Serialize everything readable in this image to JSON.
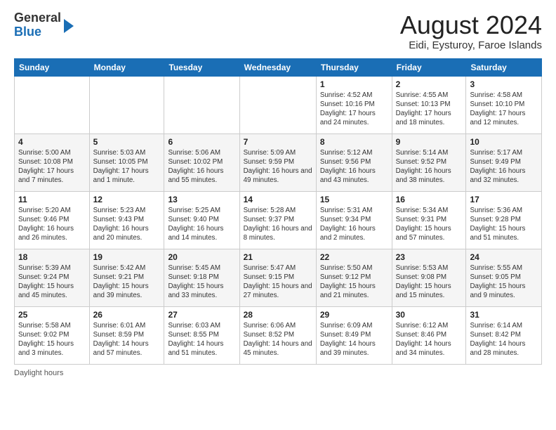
{
  "header": {
    "logo_general": "General",
    "logo_blue": "Blue",
    "month_year": "August 2024",
    "location": "Eidi, Eysturoy, Faroe Islands"
  },
  "days_of_week": [
    "Sunday",
    "Monday",
    "Tuesday",
    "Wednesday",
    "Thursday",
    "Friday",
    "Saturday"
  ],
  "footer": {
    "daylight_label": "Daylight hours"
  },
  "weeks": [
    [
      {
        "day": "",
        "info": ""
      },
      {
        "day": "",
        "info": ""
      },
      {
        "day": "",
        "info": ""
      },
      {
        "day": "",
        "info": ""
      },
      {
        "day": "1",
        "info": "Sunrise: 4:52 AM\nSunset: 10:16 PM\nDaylight: 17 hours\nand 24 minutes."
      },
      {
        "day": "2",
        "info": "Sunrise: 4:55 AM\nSunset: 10:13 PM\nDaylight: 17 hours\nand 18 minutes."
      },
      {
        "day": "3",
        "info": "Sunrise: 4:58 AM\nSunset: 10:10 PM\nDaylight: 17 hours\nand 12 minutes."
      }
    ],
    [
      {
        "day": "4",
        "info": "Sunrise: 5:00 AM\nSunset: 10:08 PM\nDaylight: 17 hours\nand 7 minutes."
      },
      {
        "day": "5",
        "info": "Sunrise: 5:03 AM\nSunset: 10:05 PM\nDaylight: 17 hours\nand 1 minute."
      },
      {
        "day": "6",
        "info": "Sunrise: 5:06 AM\nSunset: 10:02 PM\nDaylight: 16 hours\nand 55 minutes."
      },
      {
        "day": "7",
        "info": "Sunrise: 5:09 AM\nSunset: 9:59 PM\nDaylight: 16 hours\nand 49 minutes."
      },
      {
        "day": "8",
        "info": "Sunrise: 5:12 AM\nSunset: 9:56 PM\nDaylight: 16 hours\nand 43 minutes."
      },
      {
        "day": "9",
        "info": "Sunrise: 5:14 AM\nSunset: 9:52 PM\nDaylight: 16 hours\nand 38 minutes."
      },
      {
        "day": "10",
        "info": "Sunrise: 5:17 AM\nSunset: 9:49 PM\nDaylight: 16 hours\nand 32 minutes."
      }
    ],
    [
      {
        "day": "11",
        "info": "Sunrise: 5:20 AM\nSunset: 9:46 PM\nDaylight: 16 hours\nand 26 minutes."
      },
      {
        "day": "12",
        "info": "Sunrise: 5:23 AM\nSunset: 9:43 PM\nDaylight: 16 hours\nand 20 minutes."
      },
      {
        "day": "13",
        "info": "Sunrise: 5:25 AM\nSunset: 9:40 PM\nDaylight: 16 hours\nand 14 minutes."
      },
      {
        "day": "14",
        "info": "Sunrise: 5:28 AM\nSunset: 9:37 PM\nDaylight: 16 hours\nand 8 minutes."
      },
      {
        "day": "15",
        "info": "Sunrise: 5:31 AM\nSunset: 9:34 PM\nDaylight: 16 hours\nand 2 minutes."
      },
      {
        "day": "16",
        "info": "Sunrise: 5:34 AM\nSunset: 9:31 PM\nDaylight: 15 hours\nand 57 minutes."
      },
      {
        "day": "17",
        "info": "Sunrise: 5:36 AM\nSunset: 9:28 PM\nDaylight: 15 hours\nand 51 minutes."
      }
    ],
    [
      {
        "day": "18",
        "info": "Sunrise: 5:39 AM\nSunset: 9:24 PM\nDaylight: 15 hours\nand 45 minutes."
      },
      {
        "day": "19",
        "info": "Sunrise: 5:42 AM\nSunset: 9:21 PM\nDaylight: 15 hours\nand 39 minutes."
      },
      {
        "day": "20",
        "info": "Sunrise: 5:45 AM\nSunset: 9:18 PM\nDaylight: 15 hours\nand 33 minutes."
      },
      {
        "day": "21",
        "info": "Sunrise: 5:47 AM\nSunset: 9:15 PM\nDaylight: 15 hours\nand 27 minutes."
      },
      {
        "day": "22",
        "info": "Sunrise: 5:50 AM\nSunset: 9:12 PM\nDaylight: 15 hours\nand 21 minutes."
      },
      {
        "day": "23",
        "info": "Sunrise: 5:53 AM\nSunset: 9:08 PM\nDaylight: 15 hours\nand 15 minutes."
      },
      {
        "day": "24",
        "info": "Sunrise: 5:55 AM\nSunset: 9:05 PM\nDaylight: 15 hours\nand 9 minutes."
      }
    ],
    [
      {
        "day": "25",
        "info": "Sunrise: 5:58 AM\nSunset: 9:02 PM\nDaylight: 15 hours\nand 3 minutes."
      },
      {
        "day": "26",
        "info": "Sunrise: 6:01 AM\nSunset: 8:59 PM\nDaylight: 14 hours\nand 57 minutes."
      },
      {
        "day": "27",
        "info": "Sunrise: 6:03 AM\nSunset: 8:55 PM\nDaylight: 14 hours\nand 51 minutes."
      },
      {
        "day": "28",
        "info": "Sunrise: 6:06 AM\nSunset: 8:52 PM\nDaylight: 14 hours\nand 45 minutes."
      },
      {
        "day": "29",
        "info": "Sunrise: 6:09 AM\nSunset: 8:49 PM\nDaylight: 14 hours\nand 39 minutes."
      },
      {
        "day": "30",
        "info": "Sunrise: 6:12 AM\nSunset: 8:46 PM\nDaylight: 14 hours\nand 34 minutes."
      },
      {
        "day": "31",
        "info": "Sunrise: 6:14 AM\nSunset: 8:42 PM\nDaylight: 14 hours\nand 28 minutes."
      }
    ]
  ]
}
